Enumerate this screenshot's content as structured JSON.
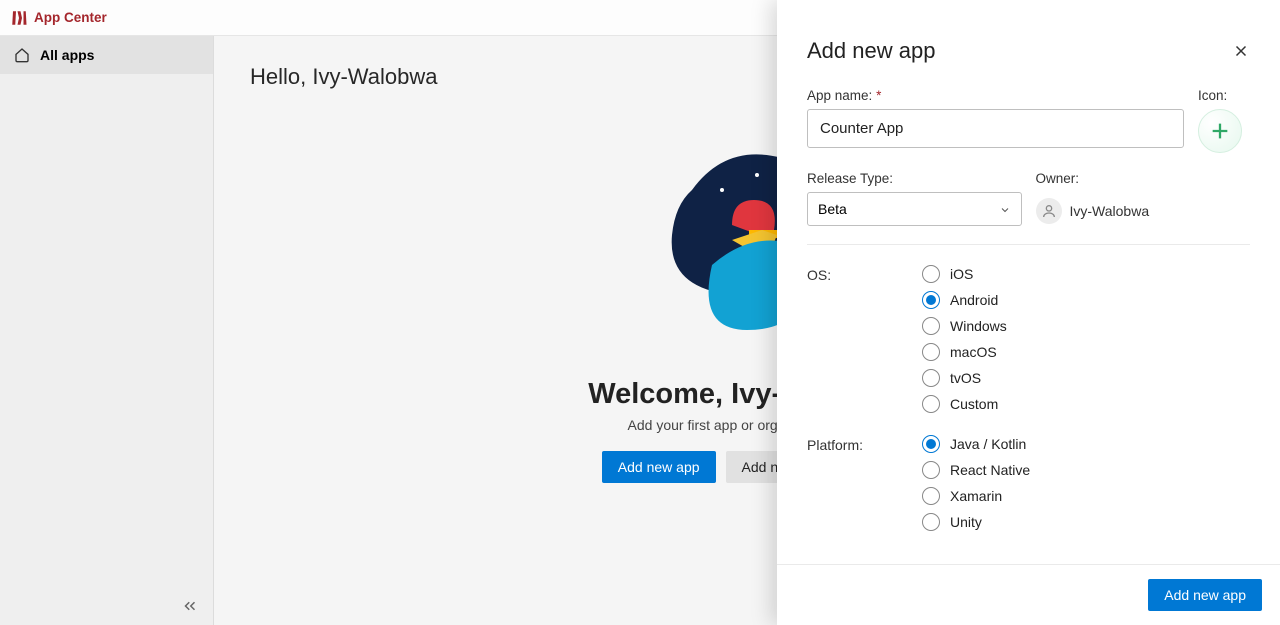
{
  "brand": {
    "name": "App Center"
  },
  "sidebar": {
    "allApps": "All apps"
  },
  "main": {
    "greeting": "Hello, Ivy-Walobwa",
    "welcomeTitle": "Welcome, Ivy-Walobwa",
    "welcomeSub": "Add your first app or organization now.",
    "addNewApp": "Add new app",
    "addNewOrg": "Add new organization"
  },
  "flyout": {
    "title": "Add new app",
    "appNameLabel": "App name:",
    "appNameValue": "Counter App",
    "iconLabel": "Icon:",
    "releaseTypeLabel": "Release Type:",
    "releaseTypeValue": "Beta",
    "ownerLabel": "Owner:",
    "ownerValue": "Ivy-Walobwa",
    "osLabel": "OS:",
    "os": [
      {
        "label": "iOS",
        "checked": false
      },
      {
        "label": "Android",
        "checked": true
      },
      {
        "label": "Windows",
        "checked": false
      },
      {
        "label": "macOS",
        "checked": false
      },
      {
        "label": "tvOS",
        "checked": false
      },
      {
        "label": "Custom",
        "checked": false
      }
    ],
    "platformLabel": "Platform:",
    "platform": [
      {
        "label": "Java / Kotlin",
        "checked": true
      },
      {
        "label": "React Native",
        "checked": false
      },
      {
        "label": "Xamarin",
        "checked": false
      },
      {
        "label": "Unity",
        "checked": false
      }
    ],
    "submit": "Add new app"
  }
}
